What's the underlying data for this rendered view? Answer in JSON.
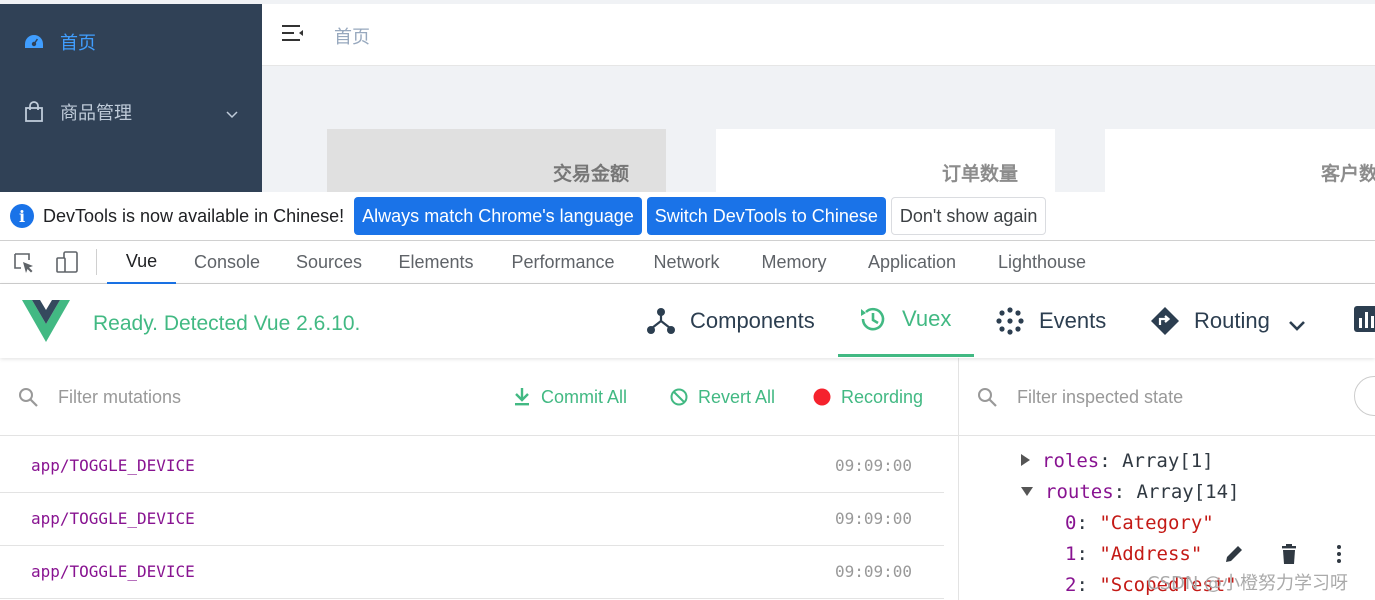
{
  "app": {
    "sidebar": {
      "items": [
        {
          "label": "首页",
          "icon": "dashboard-icon",
          "active": true
        },
        {
          "label": "商品管理",
          "icon": "shopping-bag-icon",
          "expandable": true
        }
      ]
    },
    "navbar": {
      "breadcrumb": "首页",
      "menu_icon": "hamburger-icon"
    },
    "cards": [
      {
        "label": "交易金额"
      },
      {
        "label": "订单数量"
      },
      {
        "label": "客户数"
      }
    ]
  },
  "infobar": {
    "message": "DevTools is now available in Chinese!",
    "buttons": [
      "Always match Chrome's language",
      "Switch DevTools to Chinese",
      "Don't show again"
    ]
  },
  "devtools_tabs": {
    "active": "Vue",
    "items": [
      "Vue",
      "Console",
      "Sources",
      "Elements",
      "Performance",
      "Network",
      "Memory",
      "Application",
      "Lighthouse"
    ]
  },
  "vue_header": {
    "status": "Ready. Detected Vue 2.6.10.",
    "tabs": [
      {
        "label": "Components",
        "icon": "components-icon"
      },
      {
        "label": "Vuex",
        "icon": "history-icon",
        "active": true
      },
      {
        "label": "Events",
        "icon": "events-icon"
      },
      {
        "label": "Routing",
        "icon": "routing-icon"
      }
    ],
    "accent": "#42b983"
  },
  "mutations": {
    "filter_placeholder": "Filter mutations",
    "commit_all": "Commit All",
    "revert_all": "Revert All",
    "recording": "Recording",
    "rows": [
      {
        "name": "app/TOGGLE_DEVICE",
        "time": "09:09:00"
      },
      {
        "name": "app/TOGGLE_DEVICE",
        "time": "09:09:00"
      },
      {
        "name": "app/TOGGLE_DEVICE",
        "time": "09:09:00"
      }
    ]
  },
  "state": {
    "filter_placeholder": "Filter inspected state",
    "lines": [
      {
        "key": "roles",
        "value": "Array[1]",
        "expanded": false
      },
      {
        "key": "routes",
        "value": "Array[14]",
        "expanded": true
      }
    ],
    "route_items": [
      {
        "index": "0",
        "value": "\"Category\""
      },
      {
        "index": "1",
        "value": "\"Address\""
      },
      {
        "index": "2",
        "value": "\"ScopedTest\""
      }
    ]
  },
  "watermark": "CSDN @小橙努力学习呀"
}
